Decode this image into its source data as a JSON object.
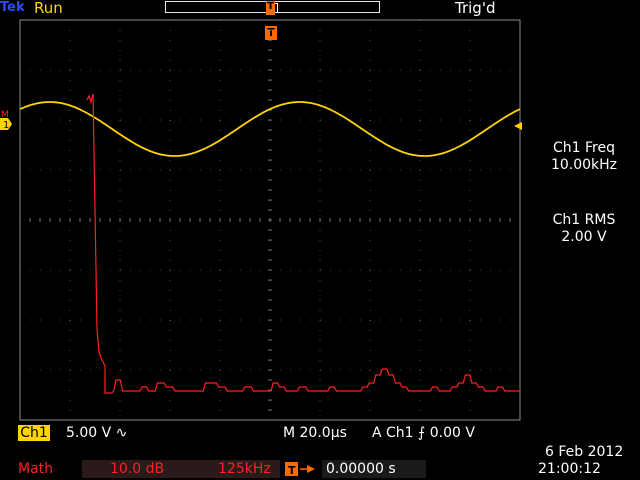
{
  "header": {
    "logo": "Tek",
    "status": "Run",
    "trigger_state": "Trig'd"
  },
  "markers": {
    "trigger_top": "T",
    "trigger": "T",
    "math_marker": "M",
    "ch1_marker": "1"
  },
  "readouts": {
    "freq_label": "Ch1 Freq",
    "freq_value": "10.00kHz",
    "rms_label": "Ch1 RMS",
    "rms_value": "2.00 V"
  },
  "footer": {
    "ch1_tag": "Ch1",
    "ch1_scale": "5.00 V ∿",
    "timebase": "M 20.0µs",
    "trigger_source": "A  Ch1  ⨍    0.00 V",
    "math_tag": "Math",
    "math_scale": "10.0 dB",
    "math_span": "125kHz",
    "trigger_position": "0.00000 s",
    "date": "6 Feb  2012",
    "time": "21:00:12"
  },
  "colors": {
    "ch1": "#ffd400",
    "math": "#ff2020",
    "trigger": "#ff6a00",
    "grid": "#8a8a8a"
  },
  "waveform": {
    "ch1_cycles_on_screen": 2
  },
  "spectrum": {
    "levels": [
      4,
      4,
      4,
      4,
      6,
      17,
      17,
      17,
      6,
      6,
      6,
      6,
      6,
      6,
      6,
      6,
      6,
      10,
      10,
      10,
      6,
      6,
      6,
      6,
      14,
      14,
      14,
      14,
      10,
      10,
      10,
      10,
      6,
      6,
      6,
      6,
      6,
      6,
      6,
      6,
      6,
      6,
      6,
      6,
      6,
      6,
      14,
      14,
      14,
      14,
      14,
      14,
      10,
      10,
      10,
      10,
      6,
      6,
      6,
      6,
      6,
      6,
      6,
      6,
      10,
      10,
      10,
      10,
      6,
      6,
      6,
      6,
      6,
      6,
      6,
      6,
      6,
      14,
      14,
      14,
      10,
      10,
      10,
      6,
      6,
      6,
      6,
      6,
      6,
      10,
      10,
      10,
      10,
      6,
      6,
      6,
      6,
      6,
      6,
      6,
      6,
      6,
      6,
      10,
      10,
      10,
      6,
      6,
      6,
      6,
      6,
      6,
      6,
      6,
      6,
      6,
      6,
      6,
      10,
      10,
      10,
      14,
      14,
      14,
      22,
      22,
      22,
      28,
      28,
      28,
      22,
      22,
      22,
      14,
      14,
      14,
      10,
      10,
      10,
      6,
      6,
      6,
      6,
      6,
      6,
      6,
      6,
      6,
      6,
      6,
      10,
      10,
      10,
      6,
      6,
      6,
      6,
      6,
      6,
      10,
      10,
      10,
      14,
      14,
      14,
      22,
      22,
      22,
      14,
      14,
      14,
      10,
      10,
      10,
      6,
      6,
      6,
      6,
      6,
      6,
      10,
      10,
      10,
      6,
      6,
      6,
      6,
      6,
      6,
      6,
      6
    ]
  }
}
